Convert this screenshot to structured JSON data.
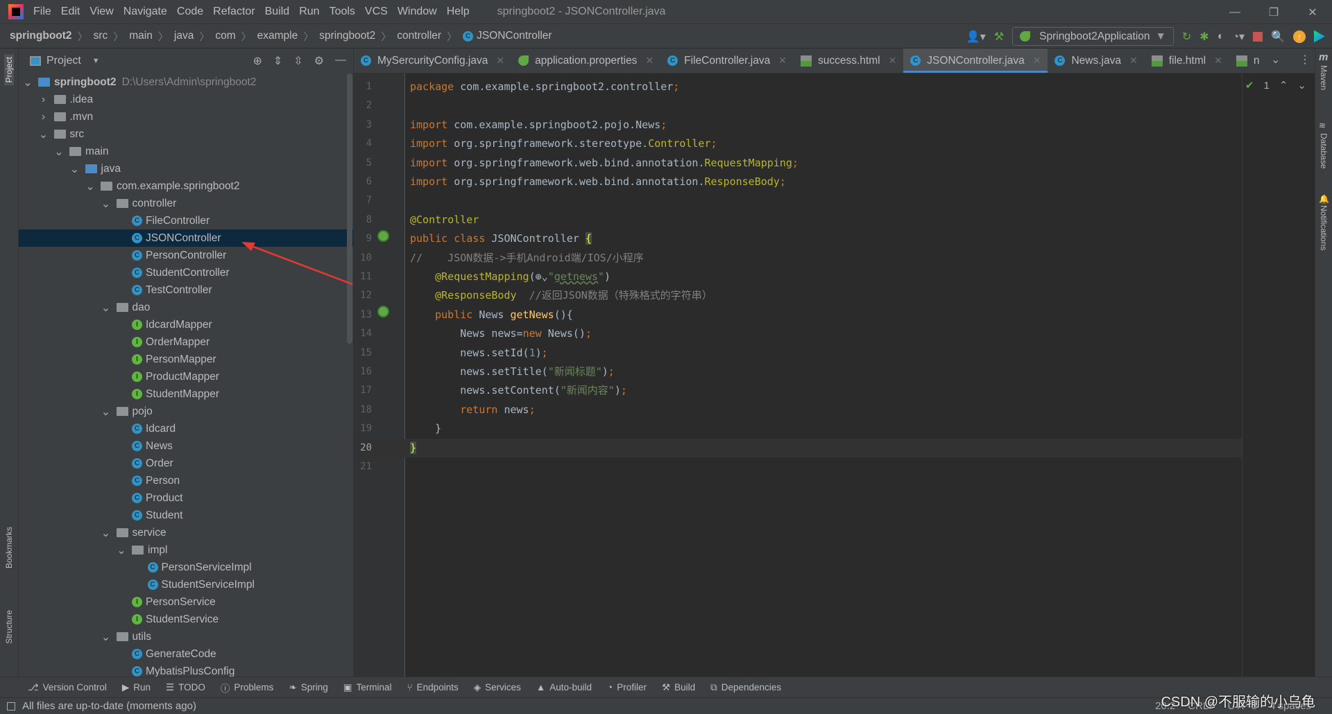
{
  "menubar": {
    "items": [
      "File",
      "Edit",
      "View",
      "Navigate",
      "Code",
      "Refactor",
      "Build",
      "Run",
      "Tools",
      "VCS",
      "Window",
      "Help"
    ],
    "window_title": "springboot2 - JSONController.java"
  },
  "breadcrumb": [
    "springboot2",
    "src",
    "main",
    "java",
    "com",
    "example",
    "springboot2",
    "controller",
    "JSONController"
  ],
  "toolbar": {
    "run_config": "Springboot2Application"
  },
  "project": {
    "title": "Project",
    "root_path": "D:\\Users\\Admin\\springboot2",
    "tree": [
      {
        "level": 0,
        "name": "springboot2",
        "type": "module",
        "expanded": true
      },
      {
        "level": 1,
        "name": ".idea",
        "type": "folder",
        "expanded": false
      },
      {
        "level": 1,
        "name": ".mvn",
        "type": "folder",
        "expanded": false
      },
      {
        "level": 1,
        "name": "src",
        "type": "folder",
        "expanded": true
      },
      {
        "level": 2,
        "name": "main",
        "type": "folder",
        "expanded": true
      },
      {
        "level": 3,
        "name": "java",
        "type": "srcfolder",
        "expanded": true
      },
      {
        "level": 4,
        "name": "com.example.springboot2",
        "type": "package",
        "expanded": true
      },
      {
        "level": 5,
        "name": "controller",
        "type": "package",
        "expanded": true
      },
      {
        "level": 6,
        "name": "FileController",
        "type": "class"
      },
      {
        "level": 6,
        "name": "JSONController",
        "type": "class",
        "selected": true
      },
      {
        "level": 6,
        "name": "PersonController",
        "type": "class"
      },
      {
        "level": 6,
        "name": "StudentController",
        "type": "class"
      },
      {
        "level": 6,
        "name": "TestController",
        "type": "class"
      },
      {
        "level": 5,
        "name": "dao",
        "type": "package",
        "expanded": true
      },
      {
        "level": 6,
        "name": "IdcardMapper",
        "type": "interface"
      },
      {
        "level": 6,
        "name": "OrderMapper",
        "type": "interface"
      },
      {
        "level": 6,
        "name": "PersonMapper",
        "type": "interface"
      },
      {
        "level": 6,
        "name": "ProductMapper",
        "type": "interface"
      },
      {
        "level": 6,
        "name": "StudentMapper",
        "type": "interface"
      },
      {
        "level": 5,
        "name": "pojo",
        "type": "package",
        "expanded": true
      },
      {
        "level": 6,
        "name": "Idcard",
        "type": "class"
      },
      {
        "level": 6,
        "name": "News",
        "type": "class"
      },
      {
        "level": 6,
        "name": "Order",
        "type": "class"
      },
      {
        "level": 6,
        "name": "Person",
        "type": "class"
      },
      {
        "level": 6,
        "name": "Product",
        "type": "class"
      },
      {
        "level": 6,
        "name": "Student",
        "type": "class"
      },
      {
        "level": 5,
        "name": "service",
        "type": "package",
        "expanded": true
      },
      {
        "level": 6,
        "name": "impl",
        "type": "package",
        "expanded": true
      },
      {
        "level": 7,
        "name": "PersonServiceImpl",
        "type": "class"
      },
      {
        "level": 7,
        "name": "StudentServiceImpl",
        "type": "class"
      },
      {
        "level": 6,
        "name": "PersonService",
        "type": "interface"
      },
      {
        "level": 6,
        "name": "StudentService",
        "type": "interface"
      },
      {
        "level": 5,
        "name": "utils",
        "type": "package",
        "expanded": true
      },
      {
        "level": 6,
        "name": "GenerateCode",
        "type": "class"
      },
      {
        "level": 6,
        "name": "MybatisPlusConfig",
        "type": "class"
      }
    ]
  },
  "tabs": [
    {
      "label": "MySercurityConfig.java",
      "icon": "class"
    },
    {
      "label": "application.properties",
      "icon": "spring"
    },
    {
      "label": "FileController.java",
      "icon": "class"
    },
    {
      "label": "success.html",
      "icon": "html"
    },
    {
      "label": "JSONController.java",
      "icon": "class",
      "active": true
    },
    {
      "label": "News.java",
      "icon": "class"
    },
    {
      "label": "file.html",
      "icon": "html"
    },
    {
      "label": "n",
      "icon": "html"
    }
  ],
  "inspection": {
    "count": "1"
  },
  "editor": {
    "current_line": 20,
    "lines": [
      [
        [
          "kw",
          "package "
        ],
        [
          "tx",
          "com.example.springboot2.controller"
        ],
        [
          "kw",
          ";"
        ]
      ],
      [],
      [
        [
          "kw",
          "import "
        ],
        [
          "tx",
          "com.example.springboot2.pojo.News"
        ],
        [
          "kw",
          ";"
        ]
      ],
      [
        [
          "kw",
          "import "
        ],
        [
          "tx",
          "org.springframework.stereotype."
        ],
        [
          "an",
          "Controller"
        ],
        [
          "kw",
          ";"
        ]
      ],
      [
        [
          "kw",
          "import "
        ],
        [
          "tx",
          "org.springframework.web.bind.annotation."
        ],
        [
          "an",
          "RequestMapping"
        ],
        [
          "kw",
          ";"
        ]
      ],
      [
        [
          "kw",
          "import "
        ],
        [
          "tx",
          "org.springframework.web.bind.annotation."
        ],
        [
          "an",
          "ResponseBody"
        ],
        [
          "kw",
          ";"
        ]
      ],
      [],
      [
        [
          "an",
          "@Controller"
        ]
      ],
      [
        [
          "kw",
          "public class "
        ],
        [
          "tx",
          "JSONController "
        ],
        [
          "br",
          "{"
        ]
      ],
      [
        [
          "cm",
          "//    JSON数据->手机Android端/IOS/小程序"
        ]
      ],
      [
        [
          "tx",
          "    "
        ],
        [
          "an",
          "@RequestMapping"
        ],
        [
          "tx",
          "(⊕⌄"
        ],
        [
          "st",
          "\""
        ],
        [
          "st ul",
          "getnews"
        ],
        [
          "st",
          "\""
        ],
        [
          "tx",
          ")"
        ]
      ],
      [
        [
          "tx",
          "    "
        ],
        [
          "an",
          "@ResponseBody  "
        ],
        [
          "cm",
          "//返回JSON数据（特殊格式的字符串）"
        ]
      ],
      [
        [
          "tx",
          "    "
        ],
        [
          "kw",
          "public "
        ],
        [
          "tx",
          "News "
        ],
        [
          "md",
          "getNews"
        ],
        [
          "tx",
          "(){"
        ]
      ],
      [
        [
          "tx",
          "        News news="
        ],
        [
          "kw",
          "new "
        ],
        [
          "tx",
          "News()"
        ],
        [
          "kw",
          ";"
        ]
      ],
      [
        [
          "tx",
          "        news.setId("
        ],
        [
          "nu",
          "1"
        ],
        [
          "tx",
          ")"
        ],
        [
          "kw",
          ";"
        ]
      ],
      [
        [
          "tx",
          "        news.setTitle("
        ],
        [
          "st",
          "\"新闻标题\""
        ],
        [
          "tx",
          ")"
        ],
        [
          "kw",
          ";"
        ]
      ],
      [
        [
          "tx",
          "        news.setContent("
        ],
        [
          "st",
          "\"新闻内容\""
        ],
        [
          "tx",
          ")"
        ],
        [
          "kw",
          ";"
        ]
      ],
      [
        [
          "tx",
          "        "
        ],
        [
          "kw",
          "return "
        ],
        [
          "tx",
          "news"
        ],
        [
          "kw",
          ";"
        ]
      ],
      [
        [
          "tx",
          "    }"
        ]
      ],
      [
        [
          "br",
          "}"
        ]
      ],
      []
    ]
  },
  "left_stripe": [
    "Project",
    "Bookmarks",
    "Structure"
  ],
  "right_stripe": [
    "Maven",
    "Database",
    "Notifications"
  ],
  "bottom_tools": [
    "Version Control",
    "Run",
    "TODO",
    "Problems",
    "Spring",
    "Terminal",
    "Endpoints",
    "Services",
    "Auto-build",
    "Profiler",
    "Build",
    "Dependencies"
  ],
  "status": {
    "message": "All files are up-to-date (moments ago)",
    "position": "20:2",
    "line_sep": "CRLF",
    "encoding": "UTF-8",
    "indent": "4 spaces"
  },
  "watermark": "CSDN @不服输的小乌龟",
  "colors": {
    "accent": "#4a88c7",
    "selection": "#0d293e",
    "arrow": "#e53935"
  }
}
